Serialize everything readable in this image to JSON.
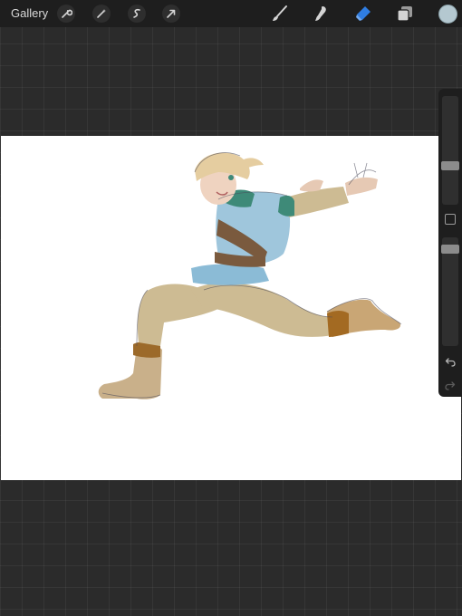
{
  "toolbar": {
    "gallery_label": "Gallery",
    "left_tools": [
      {
        "icon": "wrench-icon",
        "name": "actions-button"
      },
      {
        "icon": "magic-wand-icon",
        "name": "adjustments-button"
      },
      {
        "icon": "selection-icon",
        "name": "selection-button"
      },
      {
        "icon": "transform-arrow-icon",
        "name": "transform-button"
      }
    ],
    "right_tools": [
      {
        "icon": "brush-icon",
        "name": "paint-button",
        "active": false
      },
      {
        "icon": "smudge-icon",
        "name": "smudge-button",
        "active": false
      },
      {
        "icon": "eraser-icon",
        "name": "erase-button",
        "active": true
      },
      {
        "icon": "layers-icon",
        "name": "layers-button",
        "active": false
      }
    ],
    "current_color": "#b4c8d0",
    "active_tool_color": "#2f7de1"
  },
  "sidebar": {
    "brush_size_level": 0.35,
    "opacity_level": 0.07,
    "undo_icon": "undo-icon",
    "redo_icon": "redo-icon"
  },
  "canvas": {
    "background": "#ffffff",
    "artwork": "sketch-figure-jumping"
  }
}
